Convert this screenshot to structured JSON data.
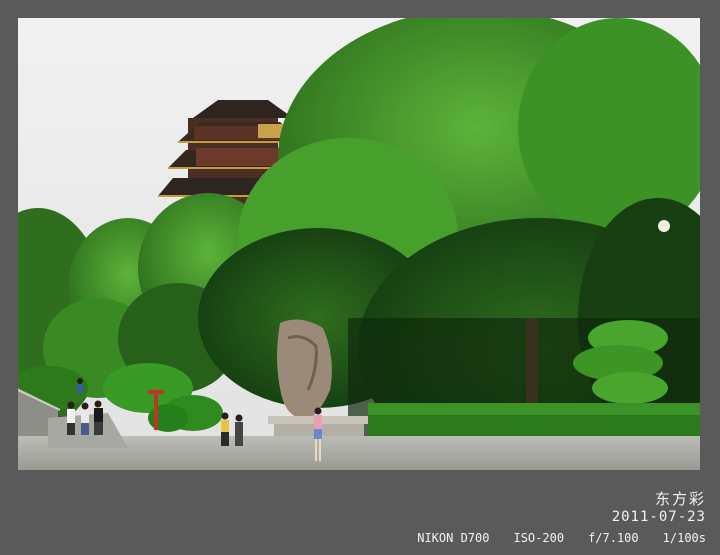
{
  "caption": {
    "title": "东方彩",
    "date": "2011-07-23",
    "exif": [
      "NIKON D700",
      "ISO-200",
      "f/7.100",
      "1/100s"
    ]
  },
  "colors": {
    "frame": "#5a5a5a",
    "sky": "#eaeaea",
    "foliage_light": "#3f9a2a",
    "foliage_dark": "#1d4d14",
    "pagoda_roof": "#3a2a22",
    "pagoda_trim": "#c79a3a"
  }
}
